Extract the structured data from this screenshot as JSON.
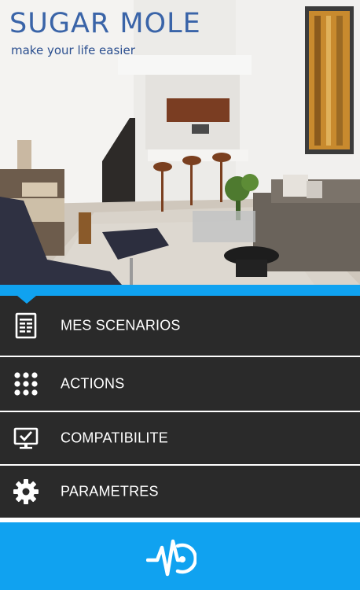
{
  "header": {
    "title": "SUGAR MOLE",
    "subtitle": "make your life easier"
  },
  "menu": {
    "items": [
      {
        "label": "MES SCENARIOS",
        "icon": "document-icon"
      },
      {
        "label": "ACTIONS",
        "icon": "grid-dots-icon"
      },
      {
        "label": "COMPATIBILITE",
        "icon": "monitor-check-icon"
      },
      {
        "label": "PARAMETRES",
        "icon": "gear-icon"
      }
    ]
  },
  "bottom_bar": {
    "icon": "pulse-logo-icon"
  },
  "colors": {
    "accent": "#10a2f0",
    "menu_bg": "#2a2a2a",
    "brand_blue": "#3a64a8"
  }
}
